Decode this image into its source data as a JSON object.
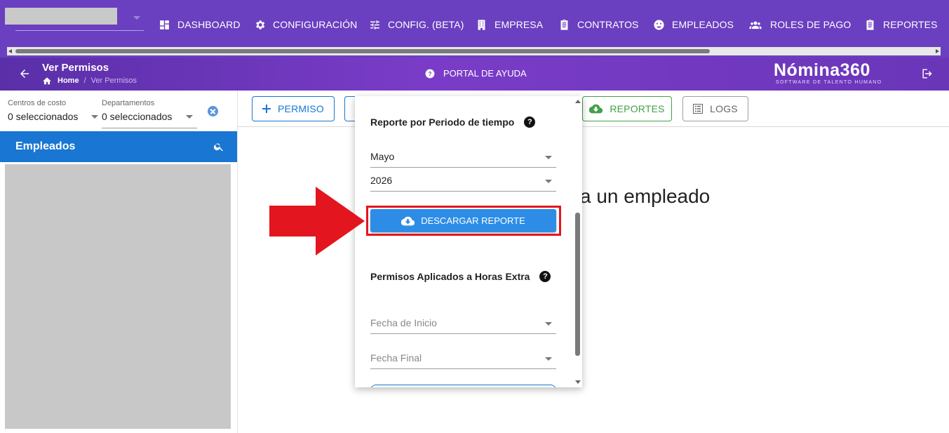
{
  "nav": {
    "items": [
      {
        "label": "DASHBOARD",
        "icon": "dashboard-icon"
      },
      {
        "label": "CONFIGURACIÓN",
        "icon": "gear-icon"
      },
      {
        "label": "CONFIG. (BETA)",
        "icon": "tune-icon"
      },
      {
        "label": "EMPRESA",
        "icon": "building-icon"
      },
      {
        "label": "CONTRATOS",
        "icon": "clipboard-icon"
      },
      {
        "label": "EMPLEADOS",
        "icon": "face-icon"
      },
      {
        "label": "ROLES DE PAGO",
        "icon": "group-icon"
      },
      {
        "label": "REPORTES",
        "icon": "report-icon"
      }
    ]
  },
  "header": {
    "title": "Ver Permisos",
    "breadcrumb_home": "Home",
    "breadcrumb_sep": "/",
    "breadcrumb_current": "Ver Permisos",
    "help_label": "PORTAL DE AYUDA",
    "logo": "Nómina360",
    "logo_tagline": "SOFTWARE DE TALENTO HUMANO"
  },
  "filters": {
    "cost_centers_label": "Centros de costo",
    "cost_centers_value": "0 seleccionados",
    "departments_label": "Departamentos",
    "departments_value": "0 seleccionados"
  },
  "employees": {
    "title": "Empleados"
  },
  "toolbar": {
    "permiso_label": "PERMISO",
    "reportes_label": "REPORTES",
    "logs_label": "LOGS"
  },
  "main": {
    "message_fragment": "a un empleado"
  },
  "panel": {
    "section1_title": "Reporte por Periodo de tiempo",
    "month_value": "Mayo",
    "year_value": "2026",
    "download_label": "DESCARGAR REPORTE",
    "section2_title": "Permisos Aplicados a Horas Extra",
    "start_placeholder": "Fecha de Inicio",
    "end_placeholder": "Fecha Final",
    "help_glyph": "?"
  },
  "colors": {
    "nav_bg": "#6a3fc0",
    "primary": "#1976d2",
    "success": "#43a047",
    "download_btn": "#2d8de6",
    "annotation_red": "#e3161f"
  }
}
